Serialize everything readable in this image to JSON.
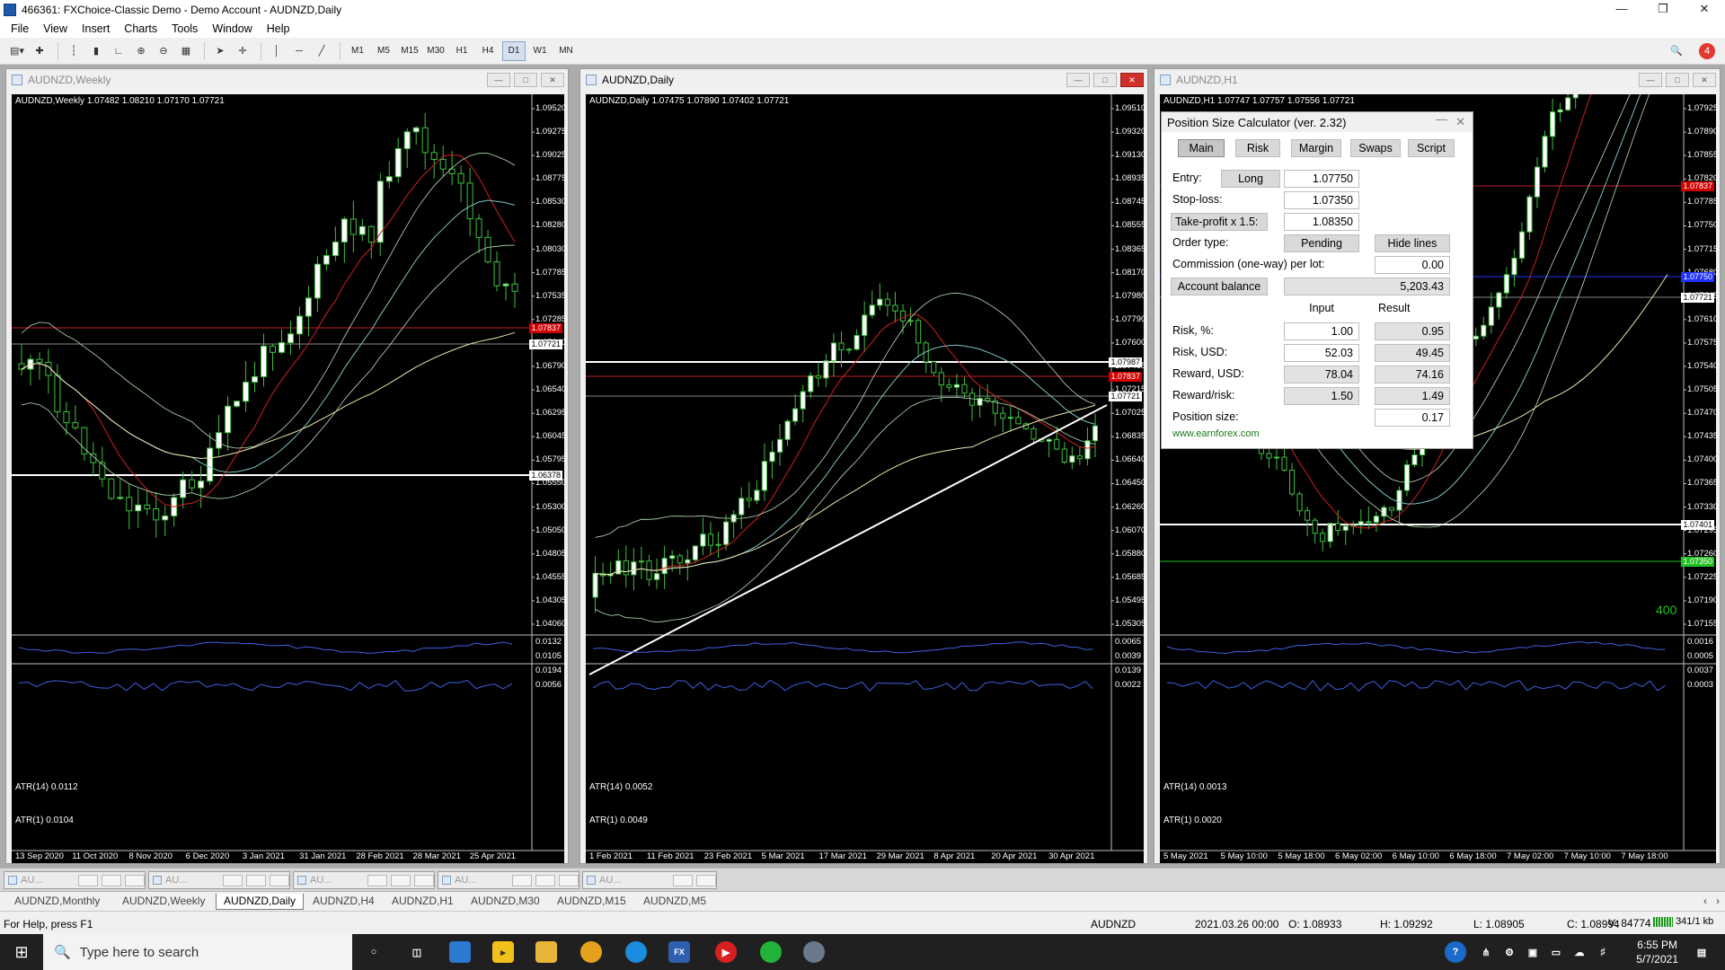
{
  "window": {
    "title": "466361: FXChoice-Classic Demo - Demo Account - AUDNZD,Daily"
  },
  "menu": [
    "File",
    "View",
    "Insert",
    "Charts",
    "Tools",
    "Window",
    "Help"
  ],
  "timeframes": [
    "M1",
    "M5",
    "M15",
    "M30",
    "H1",
    "H4",
    "D1",
    "W1",
    "MN"
  ],
  "charts": {
    "weekly": {
      "title": "AUDNZD,Weekly",
      "info": "AUDNZD,Weekly  1.07482 1.08210 1.07170 1.07721",
      "prices": [
        "1.09520",
        "1.09275",
        "1.09025",
        "1.08775",
        "1.08530",
        "1.08280",
        "1.08030",
        "1.07785",
        "1.07535",
        "1.07285",
        "1.07040",
        "1.06790",
        "1.06540",
        "1.06295",
        "1.06045",
        "1.05795",
        "1.05550",
        "1.05300",
        "1.05050",
        "1.04805",
        "1.04555",
        "1.04305",
        "1.04060"
      ],
      "tags": [
        {
          "text": "1.07837",
          "color": "#d00000"
        },
        {
          "text": "1.07721",
          "color": "#ffffff"
        },
        {
          "text": "1.06378",
          "color": "#ffffff"
        }
      ],
      "atr14": "ATR(14) 0.0112",
      "atr14_scale": [
        "0.0132",
        "0.0105"
      ],
      "atr1": "ATR(1) 0.0104",
      "atr1_scale": [
        "0.0194",
        "0.0056"
      ],
      "dates": [
        "13 Sep 2020",
        "11 Oct 2020",
        "8 Nov 2020",
        "6 Dec 2020",
        "3 Jan 2021",
        "31 Jan 2021",
        "28 Feb 2021",
        "28 Mar 2021",
        "25 Apr 2021"
      ]
    },
    "daily": {
      "title": "AUDNZD,Daily",
      "info": "AUDNZD,Daily  1.07475 1.07890 1.07402 1.07721",
      "prices": [
        "1.09510",
        "1.09320",
        "1.09130",
        "1.08935",
        "1.08745",
        "1.08555",
        "1.08365",
        "1.08170",
        "1.07980",
        "1.07790",
        "1.07600",
        "1.07405",
        "1.07215",
        "1.07025",
        "1.06835",
        "1.06640",
        "1.06450",
        "1.06260",
        "1.06070",
        "1.05880",
        "1.05685",
        "1.05495",
        "1.05305"
      ],
      "tags": [
        {
          "text": "1.07987",
          "color": "#ffffff"
        },
        {
          "text": "1.07837",
          "color": "#d00000"
        },
        {
          "text": "1.07721",
          "color": "#ffffff"
        }
      ],
      "atr14": "ATR(14) 0.0052",
      "atr14_scale": [
        "0.0065",
        "0.0039"
      ],
      "atr1": "ATR(1) 0.0049",
      "atr1_scale": [
        "0.0139",
        "0.0022"
      ],
      "dates": [
        "1 Feb 2021",
        "11 Feb 2021",
        "23 Feb 2021",
        "5 Mar 2021",
        "17 Mar 2021",
        "29 Mar 2021",
        "8 Apr 2021",
        "20 Apr 2021",
        "30 Apr 2021"
      ]
    },
    "h1": {
      "title": "AUDNZD,H1",
      "info": "AUDNZD,H1  1.07747 1.07757 1.07556 1.07721",
      "prices": [
        "1.07925",
        "1.07890",
        "1.07855",
        "1.07820",
        "1.07785",
        "1.07750",
        "1.07715",
        "1.07680",
        "1.07645",
        "1.07610",
        "1.07575",
        "1.07540",
        "1.07505",
        "1.07470",
        "1.07435",
        "1.07400",
        "1.07365",
        "1.07330",
        "1.07295",
        "1.07260",
        "1.07225",
        "1.07190",
        "1.07155"
      ],
      "tags": [
        {
          "text": "1.07837",
          "color": "#d00000"
        },
        {
          "text": "1.07750",
          "color": "#2030ff"
        },
        {
          "text": "1.07721",
          "color": "#ffffff"
        },
        {
          "text": "1.07401",
          "color": "#ffffff"
        },
        {
          "text": "1.07350",
          "color": "#21c321"
        }
      ],
      "sl_points": "400",
      "atr14": "ATR(14) 0.0013",
      "atr14_scale": [
        "0.0016",
        "0.0005"
      ],
      "atr1": "ATR(1) 0.0020",
      "atr1_scale": [
        "0.0037",
        "0.0003"
      ],
      "dates": [
        "5 May 2021",
        "5 May 10:00",
        "5 May 18:00",
        "6 May 02:00",
        "6 May 10:00",
        "6 May 18:00",
        "7 May 02:00",
        "7 May 10:00",
        "7 May 18:00"
      ]
    }
  },
  "psc": {
    "title": "Position Size Calculator (ver. 2.32)",
    "tabs": [
      "Main",
      "Risk",
      "Margin",
      "Swaps",
      "Script"
    ],
    "entry_label": "Entry:",
    "direction": "Long",
    "entry": "1.07750",
    "sl_label": "Stop-loss:",
    "sl": "1.07350",
    "tp_label": "Take-profit x 1.5:",
    "tp": "1.08350",
    "order_type_label": "Order type:",
    "order_type": "Pending",
    "hide_lines": "Hide lines",
    "commission_label": "Commission (one-way) per lot:",
    "commission": "0.00",
    "account_balance_label": "Account balance",
    "account_balance": "5,203.43",
    "col_input": "Input",
    "col_result": "Result",
    "risk_pct_label": "Risk, %:",
    "risk_pct_input": "1.00",
    "risk_pct_result": "0.95",
    "risk_usd_label": "Risk, USD:",
    "risk_usd_input": "52.03",
    "risk_usd_result": "49.45",
    "reward_usd_label": "Reward, USD:",
    "reward_usd_input": "78.04",
    "reward_usd_result": "74.16",
    "rr_label": "Reward/risk:",
    "rr_input": "1.50",
    "rr_result": "1.49",
    "pos_size_label": "Position size:",
    "pos_size": "0.17",
    "link": "www.earnforex.com"
  },
  "mdi_tabs": [
    "AU...",
    "AU...",
    "AU...",
    "AU...",
    "AU..."
  ],
  "symbol_tabs": [
    "AUDNZD,Monthly",
    "AUDNZD,Weekly",
    "AUDNZD,Daily",
    "AUDNZD,H4",
    "AUDNZD,H1",
    "AUDNZD,M30",
    "AUDNZD,M15",
    "AUDNZD,M5"
  ],
  "active_symbol_tab": 2,
  "status": {
    "help": "For Help, press F1",
    "symbol": "AUDNZD",
    "datetime": "2021.03.26 00:00",
    "open": "O: 1.08933",
    "high": "H: 1.09292",
    "low": "L: 1.08905",
    "close": "C: 1.08994",
    "volume": "V: 84774",
    "traffic": "341/1 kb"
  },
  "taskbar": {
    "search_placeholder": "Type here to search",
    "time": "6:55 PM",
    "date": "5/7/2021"
  }
}
